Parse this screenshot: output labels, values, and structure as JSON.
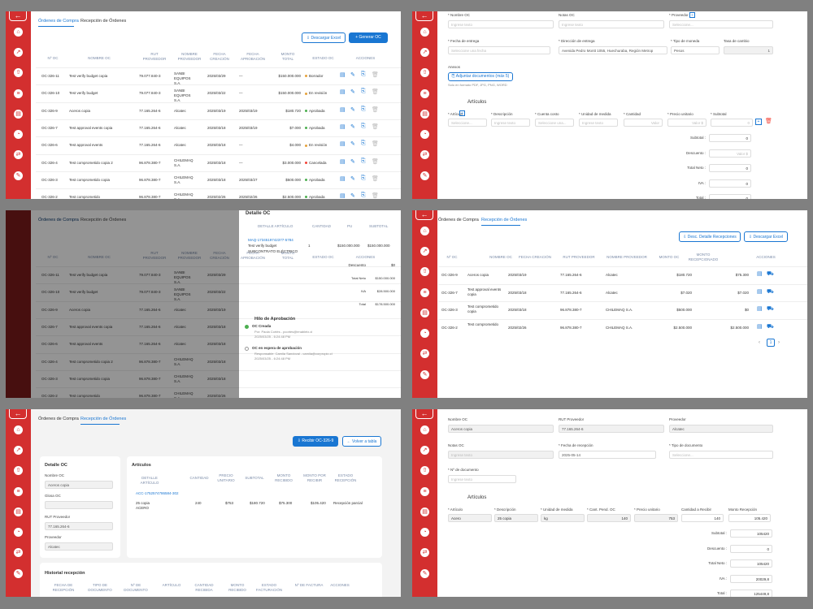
{
  "p1": {
    "tabs": [
      "Órdenes de Compra",
      "Recepción de Órdenes"
    ],
    "btn_excel": "Descargar Excel",
    "btn_new": "Generar OC",
    "headers": [
      "Nº OC",
      "NOMBRE OC",
      "RUT PROVEEDOR",
      "NOMBRE PROVEEDOR",
      "FECHA CREACIÓN",
      "FECHA APROBACIÓN",
      "MONTO TOTAL",
      "ESTADO OC",
      "ACCIONES"
    ],
    "rows": [
      {
        "oc": "OC-326-11",
        "name": "Test verify budget copia",
        "rut": "79.077.840-3",
        "prov": "SANBI EQUIPOS S.A.",
        "created": "2025/03/29",
        "approved": "—",
        "total": "$150.000.000",
        "status": "Borrador",
        "color": "#e6a23c"
      },
      {
        "oc": "OC-326-10",
        "name": "Test verify budget",
        "rut": "79.077.840-3",
        "prov": "SANBI EQUIPOS S.A.",
        "created": "2025/03/22",
        "approved": "—",
        "total": "$150.000.000",
        "status": "En revisión",
        "color": "#e6a23c"
      },
      {
        "oc": "OC-326-9",
        "name": "Aceros copia",
        "rut": "77.165.264-6",
        "prov": "Alcatec",
        "created": "2025/03/19",
        "approved": "2025/03/19",
        "total": "$180.720",
        "status": "Aprobada",
        "color": "#4caf50"
      },
      {
        "oc": "OC-326-7",
        "name": "Test approval events copia",
        "rut": "77.165.264-6",
        "prov": "Alcatec",
        "created": "2025/03/18",
        "approved": "2025/03/19",
        "total": "$7.000",
        "status": "Aprobada",
        "color": "#4caf50"
      },
      {
        "oc": "OC-326-6",
        "name": "Test approval events",
        "rut": "77.165.264-6",
        "prov": "Alcatec",
        "created": "2025/03/18",
        "approved": "—",
        "total": "$4.000",
        "status": "En revisión",
        "color": "#e6a23c"
      },
      {
        "oc": "OC-326-4",
        "name": "Test comprometido copia 2",
        "rut": "96.878.380-7",
        "prov": "CHILEMAQ S.A.",
        "created": "2025/03/18",
        "approved": "—",
        "total": "$3.000.000",
        "status": "Cancelada",
        "color": "#f44336"
      },
      {
        "oc": "OC-326-3",
        "name": "Test comprometido copia",
        "rut": "96.878.380-7",
        "prov": "CHILEMAQ S.A.",
        "created": "2025/03/18",
        "approved": "2025/03/27",
        "total": "$500.000",
        "status": "Aprobada",
        "color": "#4caf50"
      },
      {
        "oc": "OC-326-2",
        "name": "Test comprometido",
        "rut": "96.878.380-7",
        "prov": "CHILEMAQ S.A.",
        "created": "2025/02/26",
        "approved": "2025/02/26",
        "total": "$2.500.000",
        "status": "Aprobada",
        "color": "#4caf50"
      }
    ]
  },
  "p2": {
    "labels": [
      "* Nombre OC",
      "Notas OC",
      "* Proveedor",
      "* Fecha de entrega",
      "* Dirección de entrega",
      "* Tipo de moneda",
      "Tasa de cambio"
    ],
    "ph_name": "Ingrese texto",
    "ph_notes": "Ingrese texto",
    "ph_prov": "Seleccione...",
    "ph_date": "Seleccione una fecha",
    "address": "Avenida Pedro Montt 1055, Huechuraba, Región Metrop",
    "currency": "Pesos",
    "rate": "1",
    "annex": "Anexos",
    "annex_btn": "Adjuntar documentos (máx 5)",
    "annex_note": "Solo en formato PDF, JPG, PNG, WORD",
    "articles": "Artículos",
    "art_headers": [
      "* Artículo",
      "* Descripción",
      "* Cuenta costo",
      "* Unidad de medida",
      "* Cantidad",
      "* Precio unitario",
      "* Subtotal"
    ],
    "art_ph": [
      "Seleccione...",
      "Ingrese texto",
      "Seleccione una...",
      "Ingrese texto",
      "Valor",
      "Valor $",
      "0"
    ],
    "totals": [
      [
        "Subtotal :",
        "0"
      ],
      [
        "Descuento :",
        "Valor $"
      ],
      [
        "Total Neto :",
        "0"
      ],
      [
        "IVA :",
        "0"
      ],
      [
        "Total :",
        "0"
      ]
    ]
  },
  "p3": {
    "title": "Detalle OC",
    "headers": [
      "DETALLE ARTÍCULO",
      "CANTIDAD",
      "PU",
      "SUBTOTAL"
    ],
    "item_code": "MAQ-1734519742377-5784",
    "item_name": "Test verify budget",
    "item_desc": "SUBCONTRATO ELÉCTRICO",
    "item_qty": "1",
    "item_pu": "$150.000.000",
    "item_sub": "$150.000.000",
    "sums": [
      [
        "Descuento",
        "$0"
      ],
      [
        "Total Neto",
        "$150.000.000"
      ],
      [
        "IVA",
        "$28.500.000"
      ],
      [
        "Total",
        "$178.500.000"
      ]
    ],
    "thread": "Hilo de Aprobación",
    "step1_title": "OC Creada",
    "step1_by": "Por: Paola Cortés - pcortes@enableix.cl",
    "step1_date": "2025/03/25 - 6:24:48 PM",
    "step2_title": "OC en espera de aprobación",
    "step2_by": "Responsable: Camila Sandoval - camila@corpropio.cl",
    "step2_date": "2025/03/25 - 6:24:48 PM"
  },
  "p4": {
    "tabs": [
      "Órdenes de Compra",
      "Recepción de Órdenes"
    ],
    "btn_detail": "Desc. Detalle Recepciones",
    "btn_excel": "Descargar Excel",
    "headers": [
      "Nº OC",
      "NOMBRE OC",
      "FECHA CREACIÓN",
      "RUT PROVEEDOR",
      "NOMBRE PROVEEDOR",
      "MONTO OC",
      "MONTO RECEPCIONADO",
      "ACCIONES"
    ],
    "rows": [
      {
        "oc": "OC-326-9",
        "name": "Aceros copia",
        "date": "2025/03/19",
        "rut": "77.165.264-6",
        "prov": "Alcatec",
        "monto": "$180.720",
        "rec": "$75.300"
      },
      {
        "oc": "OC-326-7",
        "name": "Test approval events copia",
        "date": "2025/03/18",
        "rut": "77.165.264-6",
        "prov": "Alcatec",
        "monto": "$7.020",
        "rec": "$7.020"
      },
      {
        "oc": "OC-326-3",
        "name": "Test comprometido copia",
        "date": "2025/03/18",
        "rut": "96.878.380-7",
        "prov": "CHILEMAQ S.A.",
        "monto": "$500.000",
        "rec": "$0"
      },
      {
        "oc": "OC-326-2",
        "name": "Test comprometido",
        "date": "2025/02/26",
        "rut": "96.878.380-7",
        "prov": "CHILEMAQ S.A.",
        "monto": "$2.500.000",
        "rec": "$2.500.000"
      }
    ],
    "page": "1"
  },
  "p5": {
    "tabs": [
      "Órdenes de Compra",
      "Recepción de Órdenes"
    ],
    "btn_receive": "Recibir OC-326-9",
    "btn_back": "Volver a tabla",
    "detail_title": "Detalle OC",
    "f_name_lbl": "Nombre OC",
    "f_name": "Aceros copia",
    "f_notes_lbl": "Glosa OC",
    "f_rut_lbl": "RUT Proveedor",
    "f_rut": "77.165.264-6",
    "f_prov_lbl": "Proveedor",
    "f_prov": "Alcatec",
    "art_title": "Artículos",
    "art_headers": [
      "DETALLE ARTÍCULO",
      "CANTIDAD",
      "PRECIO UNITARIO",
      "SUBTOTAL",
      "MONTO RECIBIDO",
      "MONTO POR RECIBIR",
      "ESTADO RECEPCIÓN"
    ],
    "art_code": "ACC-1752574786584-302",
    "art_desc": "25 copia",
    "art_sub": "ACERO",
    "art_qty": "240",
    "art_pu": "$753",
    "art_subtotal": "$180.720",
    "art_rec": "$75.300",
    "art_pend": "$105.420",
    "art_status": "Recepción parcial",
    "hist_title": "Historial recepción",
    "hist_headers": [
      "FECHA DE RECEPCIÓN",
      "TIPO DE DOCUMENTO",
      "Nº DE DOCUMENTO",
      "ARTÍCULO",
      "CANTIDAD RECIBIDA",
      "MONTO RECIBIDO",
      "ESTADO FACTURACIÓN",
      "Nº DE FACTURA",
      "ACCIONES"
    ]
  },
  "p6": {
    "l_name": "Nombre OC",
    "v_name": "Aceros copia",
    "l_rut": "RUT Proveedor",
    "v_rut": "77.165.264-6",
    "l_prov": "Proveedor",
    "v_prov": "Alcatec",
    "l_notes": "Notas OC",
    "v_notes": "Ingrese texto",
    "l_date": "* Fecha de recepción",
    "v_date": "2025-05-14",
    "l_doc": "* Tipo de documento",
    "v_doc": "Seleccione...",
    "l_ndoc": "* Nº de documento",
    "v_ndoc": "Ingrese texto",
    "articles": "Artículos",
    "art_headers": [
      "* Artículo",
      "* Descripción",
      "* Unidad de medida",
      "* Cant. Pend. OC",
      "* Precio unitario",
      "Cantidad a Recibir",
      "Monto Recepción"
    ],
    "art_vals": [
      "Acero",
      "25 copia",
      "kg",
      "140",
      "753",
      "140",
      "105.420"
    ],
    "totals": [
      [
        "Subtotal :",
        "105420"
      ],
      [
        "Descuento :",
        "0"
      ],
      [
        "Total Neto :",
        "105420"
      ],
      [
        "IVA :",
        "20029,8"
      ],
      [
        "Total :",
        "125449,8"
      ]
    ]
  }
}
